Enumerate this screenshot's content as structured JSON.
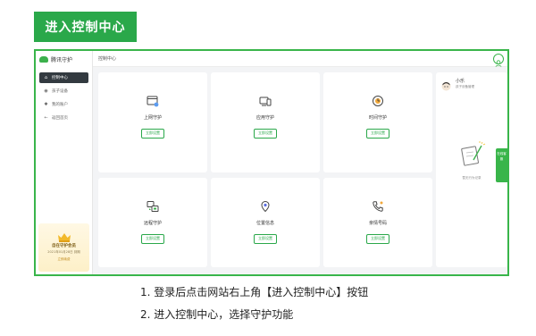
{
  "banner": {
    "title": "进入控制中心"
  },
  "app": {
    "logo_text": "腾讯守护"
  },
  "sidebar": {
    "items": [
      {
        "label": "控制中心",
        "icon": "home-icon",
        "active": true
      },
      {
        "label": "孩子设备",
        "icon": "device-icon",
        "active": false
      },
      {
        "label": "我的账户",
        "icon": "account-icon",
        "active": false
      },
      {
        "label": "返回首页",
        "icon": "back-arrow-icon",
        "active": false
      }
    ],
    "vip": {
      "title": "自在守护会员",
      "date": "2021年01月28日 到期",
      "button": "立即续费"
    }
  },
  "header": {
    "breadcrumb": "控制中心"
  },
  "cards": [
    {
      "title": "上网守护",
      "button": "立即设置",
      "icon": "browser-shield-icon"
    },
    {
      "title": "应用守护",
      "button": "立即设置",
      "icon": "app-devices-icon"
    },
    {
      "title": "时间守护",
      "button": "立即设置",
      "icon": "clock-icon"
    },
    {
      "title": "远程守护",
      "button": "立即设置",
      "icon": "remote-screen-icon"
    },
    {
      "title": "位置信息",
      "button": "立即设置",
      "icon": "location-pin-icon"
    },
    {
      "title": "亲情号码",
      "button": "立即设置",
      "icon": "phone-icon"
    }
  ],
  "profile": {
    "name": "小乐",
    "subtitle": "孩子设备管理",
    "empty_text": "暂无行为记录"
  },
  "float_tab": {
    "label": "在线客服"
  },
  "instructions": [
    "1. 登录后点击网站右上角【进入控制中心】按钮",
    "2. 进入控制中心，选择守护功能"
  ],
  "colors": {
    "accent": "#2aa84a",
    "frame_border": "#39b54a",
    "sidebar_active": "#333a40",
    "vip_bg": "#fdf0c8"
  }
}
